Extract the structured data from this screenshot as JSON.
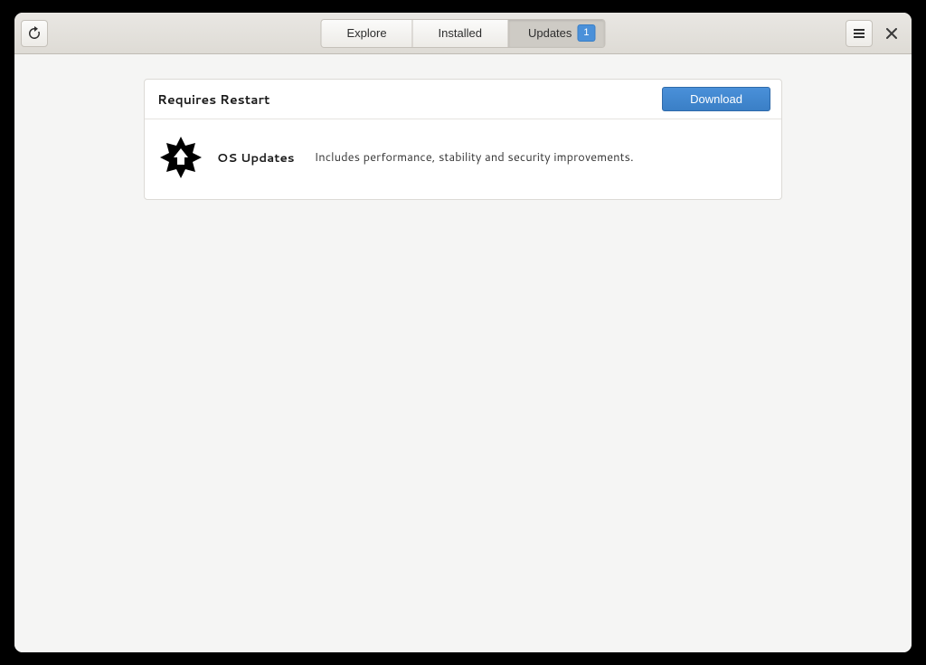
{
  "header": {
    "tabs": [
      {
        "label": "Explore"
      },
      {
        "label": "Installed"
      },
      {
        "label": "Updates",
        "badge": "1"
      }
    ]
  },
  "updates": {
    "section_title": "Requires Restart",
    "download_label": "Download",
    "items": [
      {
        "name": "OS Updates",
        "description": "Includes performance, stability and security improvements."
      }
    ]
  },
  "colors": {
    "accent": "#4a90d9"
  }
}
